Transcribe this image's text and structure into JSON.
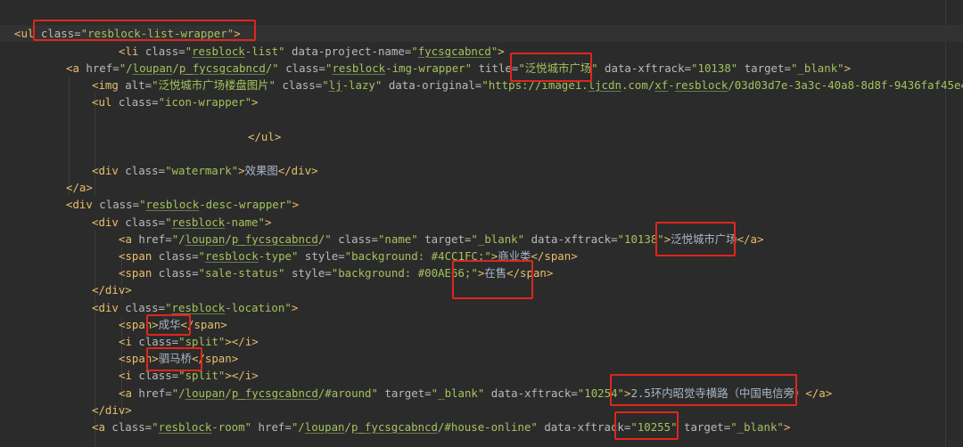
{
  "editor": {
    "lines": [
      [
        {
          "t": "<ul",
          "c": "tg"
        },
        {
          "t": " class=",
          "c": "at"
        },
        {
          "t": "\"resblock-list-wrapper\"",
          "c": "val"
        },
        {
          "t": ">",
          "c": "tg"
        }
      ],
      [
        {
          "t": "<li",
          "c": "tg"
        },
        {
          "t": " class=",
          "c": "at"
        },
        {
          "t": "\"",
          "c": "val"
        },
        {
          "t": "resblock",
          "c": "val ul"
        },
        {
          "t": "-list\"",
          "c": "val"
        },
        {
          "t": " data-project-name=",
          "c": "at"
        },
        {
          "t": "\"",
          "c": "val"
        },
        {
          "t": "fycsgcabncd",
          "c": "val ul"
        },
        {
          "t": "\"",
          "c": "val"
        },
        {
          "t": ">",
          "c": "tg"
        }
      ],
      [
        {
          "t": "<a",
          "c": "tg"
        },
        {
          "t": " href=",
          "c": "at"
        },
        {
          "t": "\"/",
          "c": "val"
        },
        {
          "t": "loupan",
          "c": "val ul"
        },
        {
          "t": "/",
          "c": "val"
        },
        {
          "t": "p_fycsgcabncd",
          "c": "val ul"
        },
        {
          "t": "/\"",
          "c": "val"
        },
        {
          "t": " class=",
          "c": "at"
        },
        {
          "t": "\"",
          "c": "val"
        },
        {
          "t": "resblock",
          "c": "val ul"
        },
        {
          "t": "-img-wrapper\"",
          "c": "val"
        },
        {
          "t": " title=",
          "c": "at"
        },
        {
          "t": "\"泛悦城市广场\"",
          "c": "val"
        },
        {
          "t": " data-xftrack=",
          "c": "at"
        },
        {
          "t": "\"10138\"",
          "c": "val"
        },
        {
          "t": " target=",
          "c": "at"
        },
        {
          "t": "\"_blank\"",
          "c": "val"
        },
        {
          "t": ">",
          "c": "tg"
        }
      ],
      [
        {
          "t": "<img",
          "c": "tg"
        },
        {
          "t": " alt=",
          "c": "at"
        },
        {
          "t": "\"泛悦城市广场楼盘图片\"",
          "c": "val"
        },
        {
          "t": " class=",
          "c": "at"
        },
        {
          "t": "\"",
          "c": "val"
        },
        {
          "t": "lj",
          "c": "val ul"
        },
        {
          "t": "-lazy\"",
          "c": "val"
        },
        {
          "t": " data-original=",
          "c": "at"
        },
        {
          "t": "\"https://image1.",
          "c": "val"
        },
        {
          "t": "ljcdn",
          "c": "val ul"
        },
        {
          "t": ".com/",
          "c": "val"
        },
        {
          "t": "xf",
          "c": "val ul"
        },
        {
          "t": "-",
          "c": "val"
        },
        {
          "t": "resblock",
          "c": "val ul"
        },
        {
          "t": "/03d03d7e-3a3c-40a8-8d8f-9436faf45e46.",
          "c": "val"
        }
      ],
      [
        {
          "t": "<ul",
          "c": "tg"
        },
        {
          "t": " class=",
          "c": "at"
        },
        {
          "t": "\"icon-wrapper\"",
          "c": "val"
        },
        {
          "t": ">",
          "c": "tg"
        }
      ],
      [],
      [
        {
          "t": "</ul>",
          "c": "tg"
        }
      ],
      [],
      [
        {
          "t": "<div",
          "c": "tg"
        },
        {
          "t": " class=",
          "c": "at"
        },
        {
          "t": "\"watermark\"",
          "c": "val"
        },
        {
          "t": ">",
          "c": "tg"
        },
        {
          "t": "效果图",
          "c": "tx"
        },
        {
          "t": "</div>",
          "c": "tg"
        }
      ],
      [
        {
          "t": "</a>",
          "c": "tg"
        }
      ],
      [
        {
          "t": "<div",
          "c": "tg"
        },
        {
          "t": " class=",
          "c": "at"
        },
        {
          "t": "\"",
          "c": "val"
        },
        {
          "t": "resblock",
          "c": "val ul"
        },
        {
          "t": "-desc-wrapper\"",
          "c": "val"
        },
        {
          "t": ">",
          "c": "tg"
        }
      ],
      [
        {
          "t": "<div",
          "c": "tg"
        },
        {
          "t": " class=",
          "c": "at"
        },
        {
          "t": "\"",
          "c": "val"
        },
        {
          "t": "resblock",
          "c": "val ul"
        },
        {
          "t": "-name\"",
          "c": "val"
        },
        {
          "t": ">",
          "c": "tg"
        }
      ],
      [
        {
          "t": "<a",
          "c": "tg"
        },
        {
          "t": " href=",
          "c": "at"
        },
        {
          "t": "\"/",
          "c": "val"
        },
        {
          "t": "loupan",
          "c": "val ul"
        },
        {
          "t": "/",
          "c": "val"
        },
        {
          "t": "p_fycsgcabncd",
          "c": "val ul"
        },
        {
          "t": "/\"",
          "c": "val"
        },
        {
          "t": " class=",
          "c": "at"
        },
        {
          "t": "\"name\"",
          "c": "val"
        },
        {
          "t": " target=",
          "c": "at"
        },
        {
          "t": "\"_blank\"",
          "c": "val"
        },
        {
          "t": " data-xftrack=",
          "c": "at"
        },
        {
          "t": "\"10138\"",
          "c": "val"
        },
        {
          "t": ">",
          "c": "tg"
        },
        {
          "t": "泛悦城市广场",
          "c": "tx"
        },
        {
          "t": "</a>",
          "c": "tg"
        }
      ],
      [
        {
          "t": "<span",
          "c": "tg"
        },
        {
          "t": " class=",
          "c": "at"
        },
        {
          "t": "\"",
          "c": "val"
        },
        {
          "t": "resblock",
          "c": "val ul"
        },
        {
          "t": "-type\"",
          "c": "val"
        },
        {
          "t": " style=",
          "c": "at"
        },
        {
          "t": "\"background: #4CC1FC;\"",
          "c": "val"
        },
        {
          "t": ">",
          "c": "tg"
        },
        {
          "t": "商业类",
          "c": "tx"
        },
        {
          "t": "</span>",
          "c": "tg"
        }
      ],
      [
        {
          "t": "<span",
          "c": "tg"
        },
        {
          "t": " class=",
          "c": "at"
        },
        {
          "t": "\"sale-status\"",
          "c": "val"
        },
        {
          "t": " style=",
          "c": "at"
        },
        {
          "t": "\"background: #00AE66;\"",
          "c": "val"
        },
        {
          "t": ">",
          "c": "tg"
        },
        {
          "t": "在售",
          "c": "tx"
        },
        {
          "t": "</span>",
          "c": "tg"
        }
      ],
      [
        {
          "t": "</div>",
          "c": "tg"
        }
      ],
      [
        {
          "t": "<div",
          "c": "tg"
        },
        {
          "t": " class=",
          "c": "at"
        },
        {
          "t": "\"",
          "c": "val"
        },
        {
          "t": "resblock",
          "c": "val ul"
        },
        {
          "t": "-location\"",
          "c": "val"
        },
        {
          "t": ">",
          "c": "tg"
        }
      ],
      [
        {
          "t": "<span>",
          "c": "tg"
        },
        {
          "t": "成华",
          "c": "tx"
        },
        {
          "t": "</span>",
          "c": "tg"
        }
      ],
      [
        {
          "t": "<i",
          "c": "tg"
        },
        {
          "t": " class=",
          "c": "at"
        },
        {
          "t": "\"split\"",
          "c": "val"
        },
        {
          "t": "></i>",
          "c": "tg"
        }
      ],
      [
        {
          "t": "<span>",
          "c": "tg"
        },
        {
          "t": "驷马桥",
          "c": "tx"
        },
        {
          "t": "</span>",
          "c": "tg"
        }
      ],
      [
        {
          "t": "<i",
          "c": "tg"
        },
        {
          "t": " class=",
          "c": "at"
        },
        {
          "t": "\"split\"",
          "c": "val"
        },
        {
          "t": "></i>",
          "c": "tg"
        }
      ],
      [
        {
          "t": "<a",
          "c": "tg"
        },
        {
          "t": " href=",
          "c": "at"
        },
        {
          "t": "\"/",
          "c": "val"
        },
        {
          "t": "loupan",
          "c": "val ul"
        },
        {
          "t": "/",
          "c": "val"
        },
        {
          "t": "p_fycsgcabncd",
          "c": "val ul"
        },
        {
          "t": "/#around\"",
          "c": "val"
        },
        {
          "t": " target=",
          "c": "at"
        },
        {
          "t": "\"_blank\"",
          "c": "val"
        },
        {
          "t": " data-xftrack=",
          "c": "at"
        },
        {
          "t": "\"10254\"",
          "c": "val"
        },
        {
          "t": ">",
          "c": "tg"
        },
        {
          "t": "2.5环内昭觉寺横路（中国电信旁）",
          "c": "tx"
        },
        {
          "t": "</a>",
          "c": "tg"
        }
      ],
      [
        {
          "t": "</div>",
          "c": "tg"
        }
      ],
      [
        {
          "t": "<a",
          "c": "tg"
        },
        {
          "t": " class=",
          "c": "at"
        },
        {
          "t": "\"",
          "c": "val"
        },
        {
          "t": "resblock",
          "c": "val ul"
        },
        {
          "t": "-room\"",
          "c": "val"
        },
        {
          "t": " href=",
          "c": "at"
        },
        {
          "t": "\"/",
          "c": "val"
        },
        {
          "t": "loupan",
          "c": "val ul"
        },
        {
          "t": "/",
          "c": "val"
        },
        {
          "t": "p_fycsgcabncd",
          "c": "val ul"
        },
        {
          "t": "/#house-online\"",
          "c": "val"
        },
        {
          "t": " data-xftrack=",
          "c": "at"
        },
        {
          "t": "\"10255\"",
          "c": "val"
        },
        {
          "t": " target=",
          "c": "at"
        },
        {
          "t": "\"_blank\"",
          "c": "val"
        },
        {
          "t": ">",
          "c": "tg"
        }
      ]
    ]
  },
  "colors": {
    "background": "#2b2b2b",
    "tag": "#e8bf6a",
    "attribute": "#bababa",
    "value": "#a5c25c",
    "text": "#a9b7c6",
    "highlight_box": "#e0261b"
  }
}
